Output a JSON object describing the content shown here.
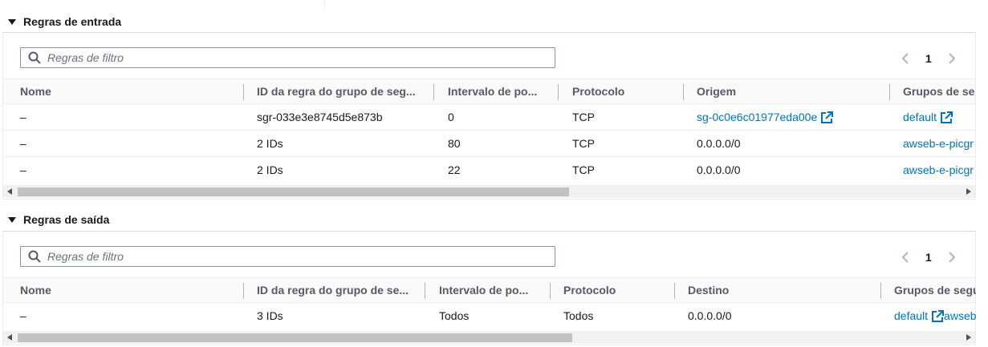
{
  "inbound": {
    "title": "Regras de entrada",
    "filter_placeholder": "Regras de filtro",
    "page": "1",
    "columns": [
      "Nome",
      "ID da regra do grupo de seg...",
      "Intervalo de po...",
      "Protocolo",
      "Origem",
      "Grupos de seg"
    ],
    "rows": [
      {
        "name": "–",
        "rule_id": "sgr-033e3e8745d5e873b",
        "port": "0",
        "protocol": "TCP",
        "source": "sg-0c0e6c01977eda00e",
        "group": "default"
      },
      {
        "name": "–",
        "rule_id": "2 IDs",
        "port": "80",
        "protocol": "TCP",
        "source": "0.0.0.0/0",
        "group": "awseb-e-picgr"
      },
      {
        "name": "–",
        "rule_id": "2 IDs",
        "port": "22",
        "protocol": "TCP",
        "source": "0.0.0.0/0",
        "group": "awseb-e-picgr"
      }
    ]
  },
  "outbound": {
    "title": "Regras de saída",
    "filter_placeholder": "Regras de filtro",
    "page": "1",
    "columns": [
      "Nome",
      "ID da regra do grupo de se...",
      "Intervalo de po...",
      "Protocolo",
      "Destino",
      "Grupos de segu"
    ],
    "rows": [
      {
        "name": "–",
        "rule_id": "3 IDs",
        "port": "Todos",
        "protocol": "Todos",
        "destination": "0.0.0.0/0",
        "group": "default",
        "group_extra": "awseb"
      }
    ]
  },
  "colors": {
    "link": "#0073bb",
    "text": "#16191f",
    "header_text": "#545b64"
  },
  "icons": {
    "search": "search-icon",
    "external": "external-link-icon",
    "prev": "chevron-left-icon",
    "next": "chevron-right-icon",
    "caret": "caret-down-icon"
  }
}
